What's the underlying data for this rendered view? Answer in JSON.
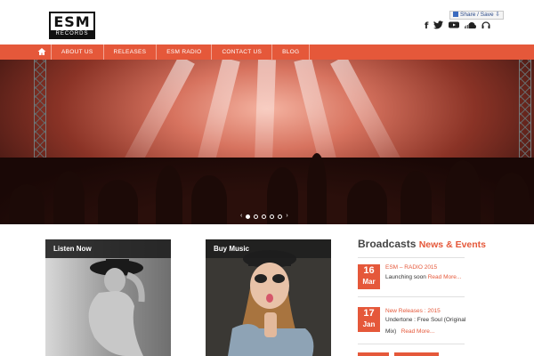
{
  "site": {
    "logo_top": "ESM",
    "logo_bottom": "RECORDS",
    "share_label": "Share / Save",
    "share_suffix": "⇩",
    "social_icons": [
      "facebook-icon",
      "twitter-icon",
      "youtube-icon",
      "soundcloud-icon",
      "headphones-icon"
    ]
  },
  "nav": {
    "home_icon": "home-icon",
    "items": [
      "ABOUT US",
      "RELEASES",
      "ESM RADIO",
      "CONTACT US",
      "BLOG"
    ]
  },
  "slider": {
    "slide_count": 5,
    "active_slide": 1,
    "prev": "‹",
    "next": "›"
  },
  "cards": {
    "listen_now": "Listen Now",
    "buy_music": "Buy Music"
  },
  "broadcasts": {
    "title": "Broadcasts",
    "subtitle": "News & Events",
    "events": [
      {
        "day": "16",
        "month": "Mar",
        "title": "ESM – RADIO 2015",
        "text": "Launching soon",
        "more": "Read More..."
      },
      {
        "day": "17",
        "month": "Jan",
        "title": "New Releases : 2015",
        "text": "Undertone : Free Soul (Original Mix)",
        "more": "Read More..."
      }
    ]
  },
  "colors": {
    "accent": "#e5583a",
    "dark": "#1e1e1e"
  }
}
